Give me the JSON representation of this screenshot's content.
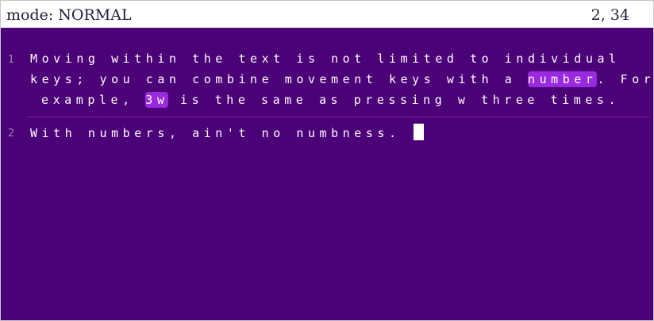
{
  "status": {
    "mode": "mode: NORMAL",
    "position": "2, 34"
  },
  "editor": {
    "lines": [
      {
        "number": "1",
        "row1": "Moving within the text is not limited to individual",
        "row2_before": "keys; you can combine movement keys with a ",
        "row2_highlight": "number",
        "row2_after": ". For",
        "row3_before": "example, ",
        "row3_highlight": "3w",
        "row3_after": " is the same as pressing w three times."
      },
      {
        "number": "2",
        "text": "With numbers, ain't no numbness. "
      }
    ]
  },
  "colors": {
    "editor_background": "#4b0078",
    "highlight": "#9a2ae0",
    "line_number": "#9b86b5",
    "separator": "#7b1fa8",
    "cursor": "#ffffff"
  }
}
